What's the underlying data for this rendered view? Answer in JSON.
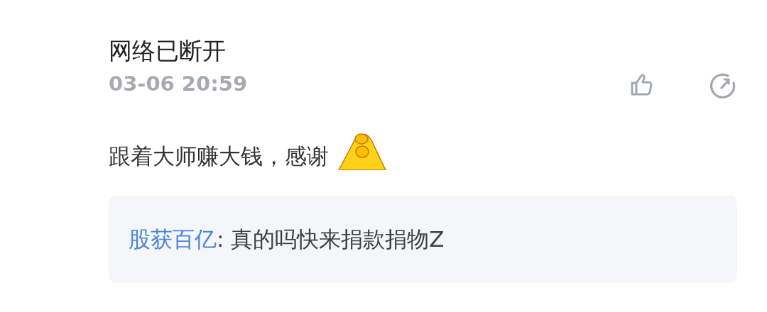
{
  "comment": {
    "username": "网络已断开",
    "time": "03-06 20:59",
    "text": "跟着大师赚大钱，感谢",
    "reply": {
      "author": "股获百亿",
      "text": ": 真的吗快来捐款捐物Z"
    }
  }
}
